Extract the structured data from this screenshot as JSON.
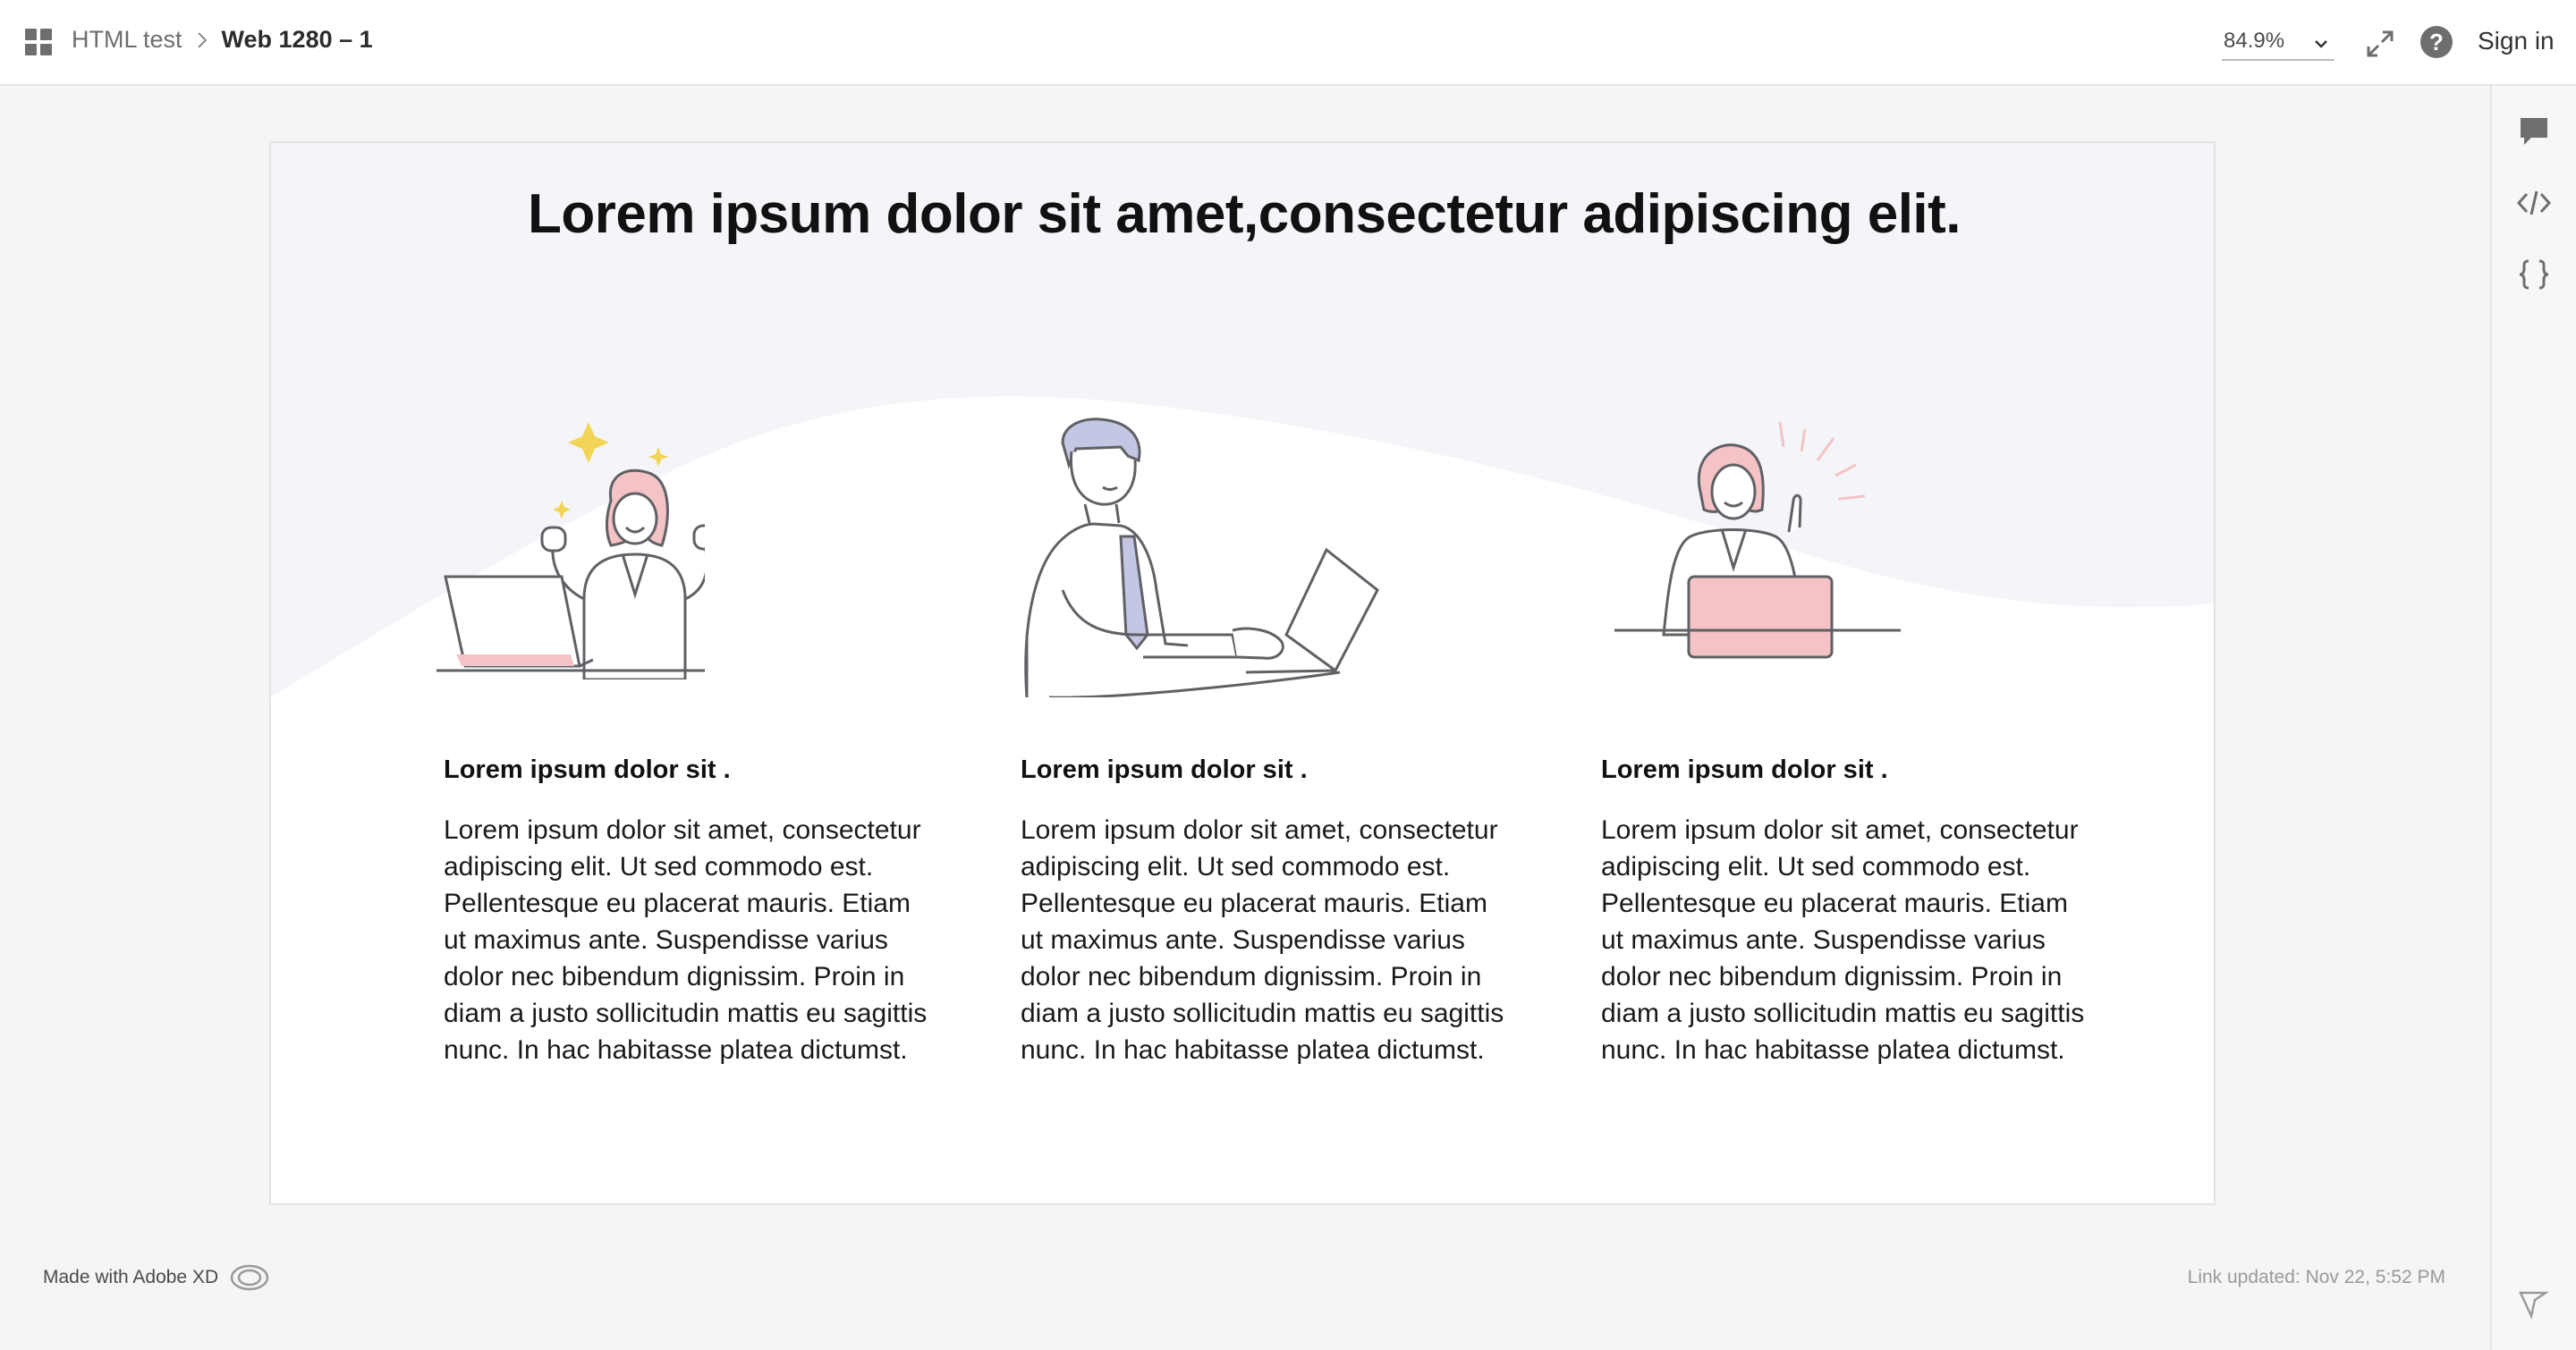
{
  "header": {
    "breadcrumb": {
      "project": "HTML test",
      "current": "Web 1280 – 1"
    },
    "zoom": "84.9%",
    "signin_label": "Sign in",
    "help_glyph": "?"
  },
  "rail": {
    "items": [
      {
        "icon": "comment-icon"
      },
      {
        "icon": "code-icon"
      },
      {
        "icon": "braces-icon"
      }
    ]
  },
  "artboard": {
    "title": "Lorem ipsum dolor sit amet,consectetur adipiscing elit.",
    "columns": [
      {
        "heading": "Lorem ipsum dolor sit .",
        "lines": [
          "Lorem ipsum dolor sit amet, consectetur",
          "adipiscing elit. Ut sed commodo est.",
          "Pellentesque eu placerat mauris. Etiam",
          "ut maximus ante. Suspendisse varius",
          "dolor nec bibendum dignissim. Proin in",
          "diam a justo sollicitudin mattis eu sagittis",
          "nunc. In hac habitasse platea dictumst."
        ],
        "illustration": "celebrating-woman-laptop"
      },
      {
        "heading": "Lorem ipsum dolor sit .",
        "lines": [
          "Lorem ipsum dolor sit amet, consectetur",
          "adipiscing elit. Ut sed commodo est.",
          "Pellentesque eu placerat mauris. Etiam",
          "ut maximus ante. Suspendisse varius",
          "dolor nec bibendum dignissim. Proin in",
          "diam a justo sollicitudin mattis eu sagittis",
          "nunc. In hac habitasse platea dictumst."
        ],
        "illustration": "man-typing-laptop"
      },
      {
        "heading": "Lorem ipsum dolor sit .",
        "lines": [
          "Lorem ipsum dolor sit amet, consectetur",
          "adipiscing elit. Ut sed commodo est.",
          "Pellentesque eu placerat mauris. Etiam",
          "ut maximus ante. Suspendisse varius",
          "dolor nec bibendum dignissim. Proin in",
          "diam a justo sollicitudin mattis eu sagittis",
          "nunc. In hac habitasse platea dictumst."
        ],
        "illustration": "woman-idea-laptop"
      }
    ]
  },
  "footer": {
    "made_with": "Made with Adobe XD",
    "link_updated": "Link updated: Nov 22, 5:52 PM"
  },
  "colors": {
    "accent_pink": "#f4c3c5",
    "accent_yellow": "#f2d456",
    "accent_lavender": "#c4c7e3",
    "wave": "#f4f5f9",
    "line": "#5f6166"
  }
}
